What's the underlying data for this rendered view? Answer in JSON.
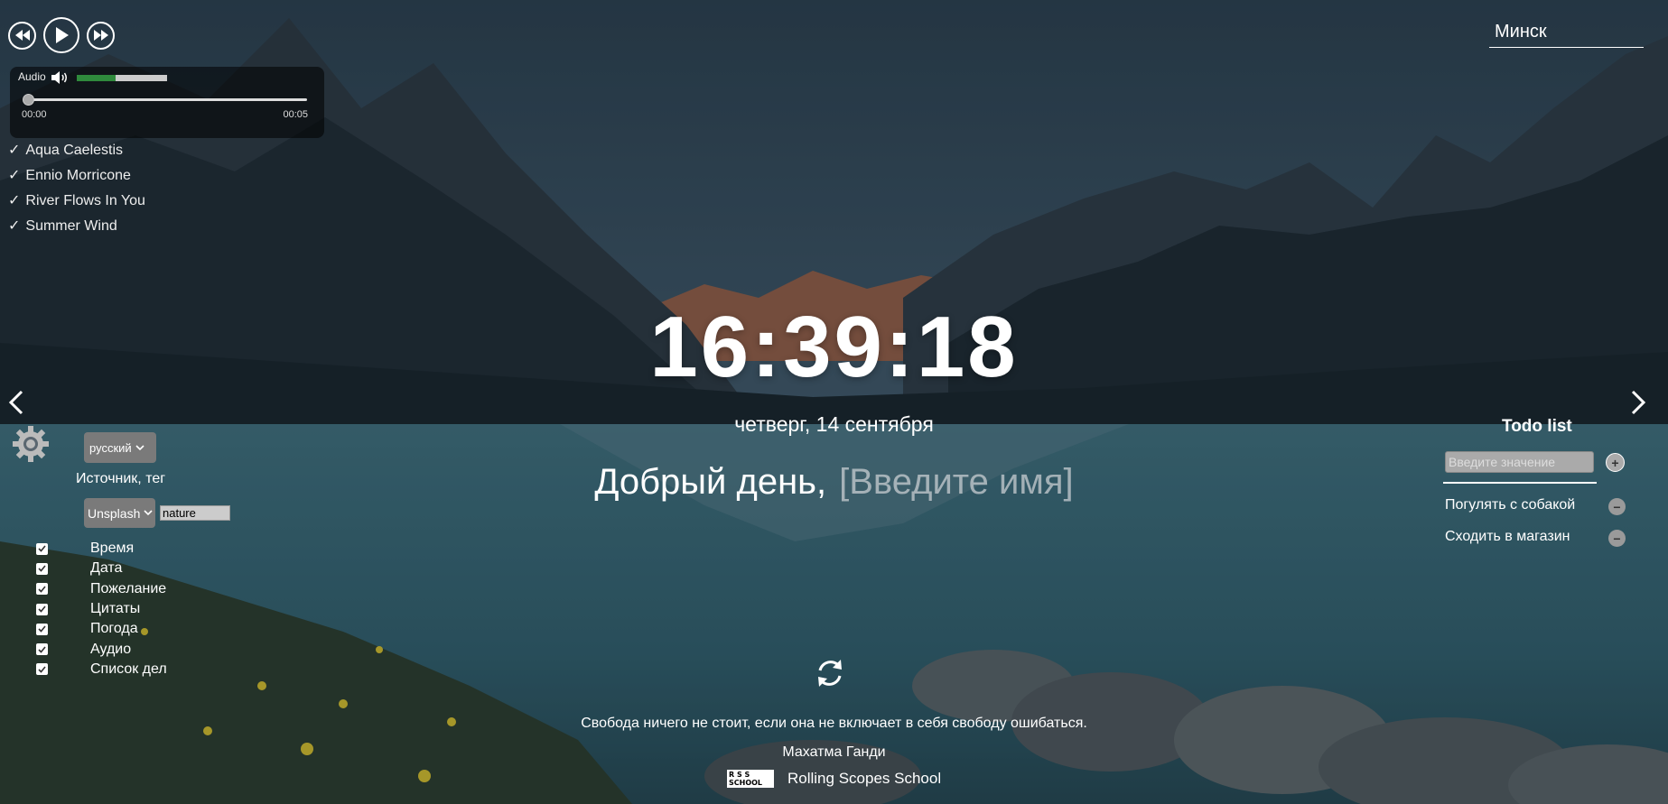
{
  "player": {
    "audio_label": "Audio",
    "volume_fraction": 0.43,
    "progress_fraction": 0.0,
    "current_time": "00:00",
    "duration": "00:05",
    "playlist": [
      {
        "title": "Aqua Caelestis"
      },
      {
        "title": "Ennio Morricone"
      },
      {
        "title": "River Flows In You"
      },
      {
        "title": "Summer Wind"
      }
    ],
    "check_glyph": "✓"
  },
  "weather": {
    "city": "Минск"
  },
  "clock": {
    "time": "16:39:18"
  },
  "date": {
    "text": "четверг, 14 сентября"
  },
  "greeting": {
    "text": "Добрый день,",
    "name_placeholder": "[Введите имя]"
  },
  "quote": {
    "text": "Свобода ничего не стоит, если она не включает в себя свободу ошибаться.",
    "author": "Махатма Ганди"
  },
  "footer": {
    "school": "Rolling Scopes School",
    "logo_text": "R S S SCHOOL"
  },
  "settings": {
    "language": "русский",
    "source_label": "Источник, тег",
    "source": "Unsplash",
    "tag": "nature",
    "toggles": [
      {
        "label": "Время",
        "checked": true
      },
      {
        "label": "Дата",
        "checked": true
      },
      {
        "label": "Пожелание",
        "checked": true
      },
      {
        "label": "Цитаты",
        "checked": true
      },
      {
        "label": "Погода",
        "checked": true
      },
      {
        "label": "Аудио",
        "checked": true
      },
      {
        "label": "Список дел",
        "checked": true
      }
    ]
  },
  "todo": {
    "title": "Todo list",
    "input_placeholder": "Введите значение",
    "add_glyph": "+",
    "remove_glyph": "−",
    "items": [
      {
        "text": "Погулять с собакой"
      },
      {
        "text": "Сходить в магазин"
      }
    ]
  },
  "colors": {
    "volume_fill": "#2f8a3c",
    "select_bg": "#7a7a7a"
  }
}
